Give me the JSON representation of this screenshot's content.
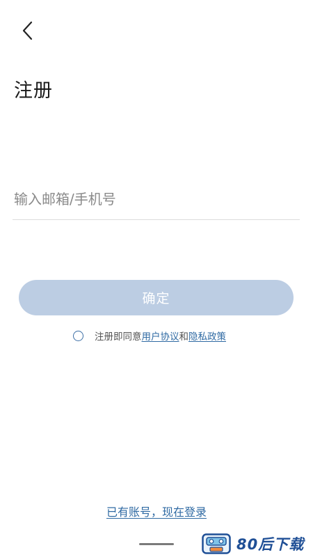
{
  "header": {
    "back_icon": "chevron-left-icon",
    "title": "注册"
  },
  "form": {
    "account_placeholder": "输入邮箱/手机号",
    "account_value": "",
    "confirm_label": "确定",
    "confirm_color": "#bccde3"
  },
  "agreement": {
    "checked": false,
    "prefix": "注册即同意",
    "user_agreement_link": "用户协议",
    "conjunction": "和",
    "privacy_policy_link": "隐私政策"
  },
  "footer": {
    "login_link": "已有账号，现在登录"
  },
  "watermark": {
    "text": "80后下载",
    "icon": "cassette-icon"
  },
  "colors": {
    "link": "#2f6aa3",
    "button_disabled": "#bccde3"
  }
}
